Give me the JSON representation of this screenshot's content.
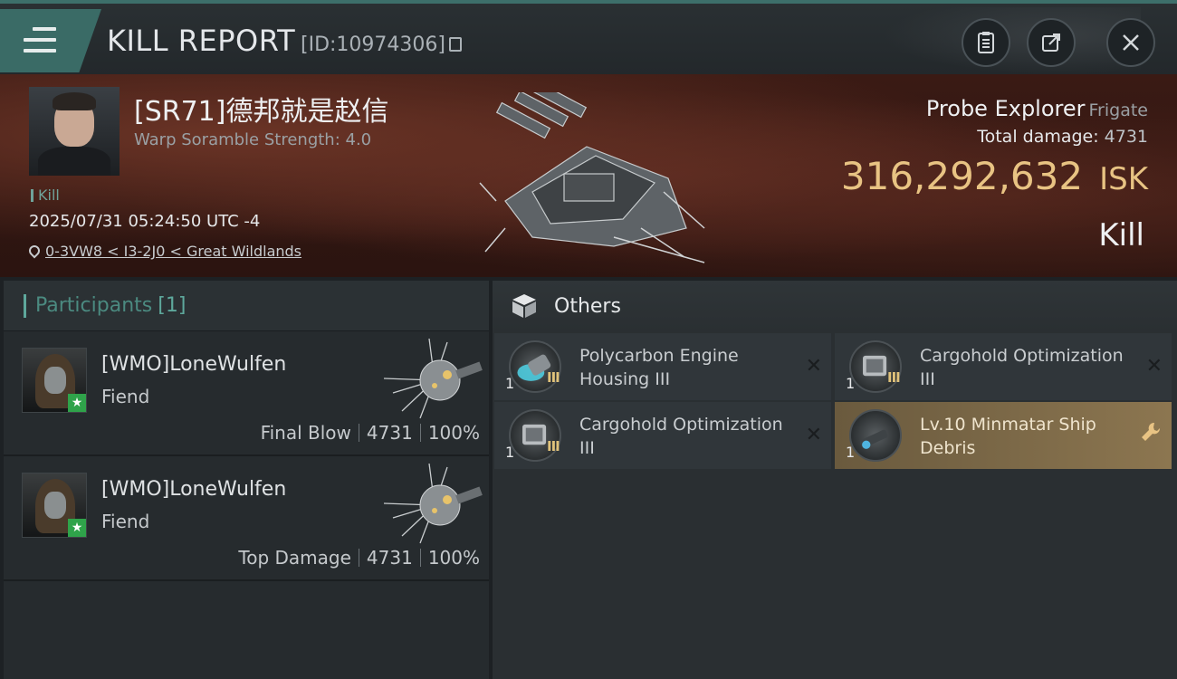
{
  "header": {
    "title": "KILL REPORT",
    "report_id": "[ID:10974306]"
  },
  "victim": {
    "name": "[SR71]德邦就是赵信",
    "subtitle": "Warp Soramble Strength: 4.0",
    "tag": "Kill",
    "timestamp": "2025/07/31 05:24:50 UTC -4",
    "location": "0-3VW8 < I3-2J0 < Great Wildlands"
  },
  "ship": {
    "name": "Probe Explorer",
    "class": "Frigate",
    "total_damage_label": "Total damage:",
    "total_damage": "4731",
    "value": "316,292,632",
    "currency": "ISK",
    "result": "Kill"
  },
  "participants": {
    "label": "Participants",
    "count": "[1]",
    "rows": [
      {
        "name": "[WMO]LoneWulfen",
        "ship": "Fiend",
        "role": "Final Blow",
        "damage": "4731",
        "percent": "100%"
      },
      {
        "name": "[WMO]LoneWulfen",
        "ship": "Fiend",
        "role": "Top Damage",
        "damage": "4731",
        "percent": "100%"
      }
    ]
  },
  "others": {
    "label": "Others",
    "items": [
      {
        "name": "Polycarbon Engine Housing III",
        "qty": "1",
        "tier": "III",
        "status": "destroyed",
        "icon": "engine-module-icon"
      },
      {
        "name": "Cargohold Optimization III",
        "qty": "1",
        "tier": "III",
        "status": "destroyed",
        "icon": "cargo-rig-icon"
      },
      {
        "name": "Cargohold Optimization III",
        "qty": "1",
        "tier": "III",
        "status": "destroyed",
        "icon": "cargo-rig-icon"
      },
      {
        "name": "Lv.10 Minmatar Ship Debris",
        "qty": "1",
        "tier": "",
        "status": "dropped",
        "icon": "debris-icon"
      }
    ]
  },
  "colors": {
    "accent_teal": "#5ea89c",
    "isk_gold": "#e8c383",
    "dropped_item_bg": "#8c7650"
  }
}
